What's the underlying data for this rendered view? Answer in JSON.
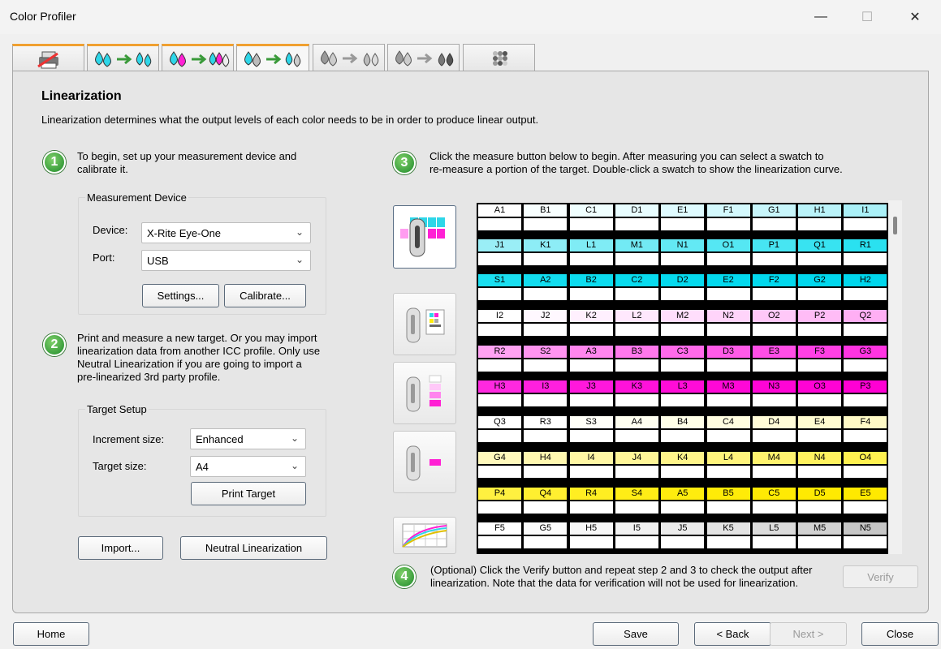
{
  "window": {
    "title": "Color Profiler",
    "minimize": "—",
    "maximize": "☐",
    "close": "✕"
  },
  "tabs": [
    {
      "name": "tab-printer-setup",
      "icon": "printer-icon"
    },
    {
      "name": "tab-cyan-to-cyan",
      "icon": "ink-drops-icon"
    },
    {
      "name": "tab-magenta-to-mixed",
      "icon": "ink-drops-icon"
    },
    {
      "name": "tab-linearization",
      "icon": "ink-drops-icon"
    },
    {
      "name": "tab-gray-to-gray",
      "icon": "ink-drops-icon"
    },
    {
      "name": "tab-gray-to-black",
      "icon": "ink-drops-icon"
    },
    {
      "name": "tab-profile-target",
      "icon": "target-icon"
    }
  ],
  "page": {
    "title": "Linearization",
    "description": "Linearization determines what the output levels of each color needs to be in order to produce linear output."
  },
  "step1": {
    "number": "1",
    "text_line1": "To begin, set up your measurement device and",
    "text_line2": "calibrate it.",
    "group_label": "Measurement Device",
    "device_label": "Device:",
    "device_value": "X-Rite Eye-One",
    "port_label": "Port:",
    "port_value": "USB",
    "settings_button": "Settings...",
    "calibrate_button": "Calibrate..."
  },
  "step2": {
    "number": "2",
    "text_lines": [
      "Print and measure a new target. Or you may import",
      "linearization data from another ICC profile. Only use",
      "Neutral Linearization if you are going to import a",
      "pre-linearized 3rd party profile."
    ],
    "group_label": "Target Setup",
    "increment_label": "Increment size:",
    "increment_value": "Enhanced",
    "target_label": "Target size:",
    "target_value": "A4",
    "print_button": "Print Target",
    "import_button": "Import...",
    "neutral_button": "Neutral Linearization"
  },
  "step3": {
    "number": "3",
    "text_line1": "Click the measure button below to begin. After measuring you can select a swatch to",
    "text_line2": "re-measure a portion of the target. Double-click a swatch to show the linearization curve."
  },
  "step4": {
    "number": "4",
    "text_line1": "(Optional) Click the Verify button and repeat step 2 and 3 to check the output after",
    "text_line2": "linearization. Note that the data for verification will not be used for linearization.",
    "verify_button": "Verify"
  },
  "footer": {
    "home": "Home",
    "save": "Save",
    "back": "< Back",
    "next": "Next >",
    "close": "Close"
  },
  "swatch_rows": [
    {
      "labels": [
        "A1",
        "B1",
        "C1",
        "D1",
        "E1",
        "F1",
        "G1",
        "H1",
        "I1"
      ],
      "colors": [
        "#ffffff",
        "#f8ffff",
        "#f0ffff",
        "#e8fdff",
        "#dffbff",
        "#d4f9fd",
        "#c8f6fb",
        "#baf3f9",
        "#aaf0f7"
      ]
    },
    {
      "labels": [
        "J1",
        "K1",
        "L1",
        "M1",
        "N1",
        "O1",
        "P1",
        "Q1",
        "R1"
      ],
      "colors": [
        "#9aeef6",
        "#8dedf6",
        "#7fecf5",
        "#72eaf4",
        "#63e9f4",
        "#55e7f3",
        "#47e5f2",
        "#38e3f1",
        "#2ae1f0"
      ]
    },
    {
      "labels": [
        "S1",
        "A2",
        "B2",
        "C2",
        "D2",
        "E2",
        "F2",
        "G2",
        "H2"
      ],
      "colors": [
        "#1adff0",
        "#12ddef",
        "#0cdcef",
        "#08dbee",
        "#05daee",
        "#03d9ee",
        "#02d8ed",
        "#01d7ed",
        "#00d6ec"
      ]
    },
    {
      "labels": [
        "I2",
        "J2",
        "K2",
        "L2",
        "M2",
        "N2",
        "O2",
        "P2",
        "Q2"
      ],
      "colors": [
        "#ffffff",
        "#fff8ff",
        "#fff0fe",
        "#ffe8fd",
        "#ffdefc",
        "#ffd4fa",
        "#ffc8f8",
        "#ffbcf6",
        "#ffaff4"
      ]
    },
    {
      "labels": [
        "R2",
        "S2",
        "A3",
        "B3",
        "C3",
        "D3",
        "E3",
        "F3",
        "G3"
      ],
      "colors": [
        "#ffa2f2",
        "#ff94f0",
        "#ff86ee",
        "#ff78ec",
        "#ff6aea",
        "#ff5be8",
        "#ff4ee6",
        "#ff40e4",
        "#ff34e2"
      ]
    },
    {
      "labels": [
        "H3",
        "I3",
        "J3",
        "K3",
        "L3",
        "M3",
        "N3",
        "O3",
        "P3"
      ],
      "colors": [
        "#ff29e0",
        "#ff20de",
        "#ff18dc",
        "#ff12da",
        "#ff0cd8",
        "#ff08d7",
        "#ff05d6",
        "#ff03d5",
        "#ff00d4"
      ]
    },
    {
      "labels": [
        "Q3",
        "R3",
        "S3",
        "A4",
        "B4",
        "C4",
        "D4",
        "E4",
        "F4"
      ],
      "colors": [
        "#ffffff",
        "#ffffff",
        "#fffff8",
        "#fffff0",
        "#ffffe8",
        "#fffde0",
        "#fffcd8",
        "#fffbd0",
        "#fffac6"
      ]
    },
    {
      "labels": [
        "G4",
        "H4",
        "I4",
        "J4",
        "K4",
        "L4",
        "M4",
        "N4",
        "O4"
      ],
      "colors": [
        "#fff9bc",
        "#fff8b0",
        "#fff7a4",
        "#fff698",
        "#fff58a",
        "#fff47c",
        "#fff36e",
        "#fff25f",
        "#fff150"
      ]
    },
    {
      "labels": [
        "P4",
        "Q4",
        "R4",
        "S4",
        "A5",
        "B5",
        "C5",
        "D5",
        "E5"
      ],
      "colors": [
        "#fff040",
        "#ffef30",
        "#ffee22",
        "#ffed16",
        "#ffec0e",
        "#ffeb08",
        "#ffea04",
        "#ffea02",
        "#ffe900"
      ]
    },
    {
      "labels": [
        "F5",
        "G5",
        "H5",
        "I5",
        "J5",
        "K5",
        "L5",
        "M5",
        "N5"
      ],
      "colors": [
        "#ffffff",
        "#fbfbfb",
        "#f7f7f7",
        "#f1f1f1",
        "#ebebeb",
        "#e3e3e3",
        "#dbdbdb",
        "#d1d1d1",
        "#c6c6c6"
      ]
    }
  ],
  "tool_icons": [
    "measure-target-icon",
    "measure-strip-icon",
    "measure-patches-icon",
    "measure-spot-icon",
    "linearization-curve-icon"
  ]
}
